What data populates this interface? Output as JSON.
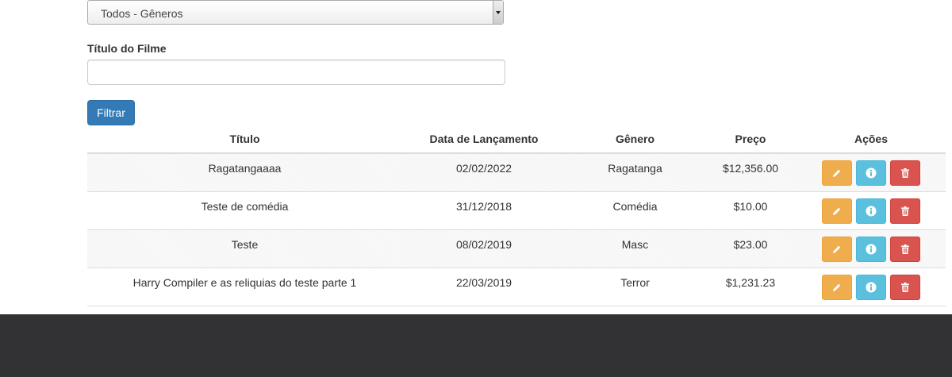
{
  "filters": {
    "genre_selected": "Todos - Gêneros",
    "title_label": "Título do Filme",
    "title_value": "",
    "filter_button": "Filtrar"
  },
  "table": {
    "headers": {
      "title": "Título",
      "release": "Data de Lançamento",
      "genre": "Gênero",
      "price": "Preço",
      "actions": "Ações"
    },
    "rows": [
      {
        "title": "Ragatangaaaa",
        "release": "02/02/2022",
        "genre": "Ragatanga",
        "price": "$12,356.00"
      },
      {
        "title": "Teste de comédia",
        "release": "31/12/2018",
        "genre": "Comédia",
        "price": "$10.00"
      },
      {
        "title": "Teste",
        "release": "08/02/2019",
        "genre": "Masc",
        "price": "$23.00"
      },
      {
        "title": "Harry Compiler e as reliquias do teste parte 1",
        "release": "22/03/2019",
        "genre": "Terror",
        "price": "$1,231.23"
      }
    ]
  },
  "icons": {
    "edit": "pencil-icon",
    "info": "info-icon",
    "delete": "trash-icon"
  },
  "colors": {
    "primary": "#337ab7",
    "warning": "#f0ad4e",
    "info": "#5bc0de",
    "danger": "#d9534f",
    "footer": "#323234"
  }
}
